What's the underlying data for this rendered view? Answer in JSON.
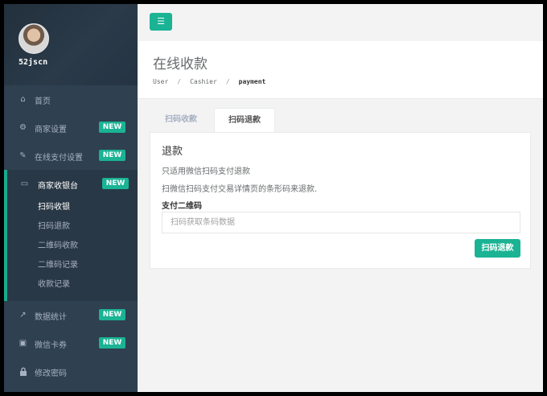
{
  "profile": {
    "username": "52jscn"
  },
  "topbar": {
    "menu_icon": "☰"
  },
  "sidebar": {
    "items": [
      {
        "label": "首页",
        "icon": "home-icon",
        "glyph": "⌂",
        "badge": ""
      },
      {
        "label": "商家设置",
        "icon": "cogs-icon",
        "glyph": "⚙",
        "badge": "NEW"
      },
      {
        "label": "在线支付设置",
        "icon": "wrench-icon",
        "glyph": "✎",
        "badge": "NEW"
      }
    ],
    "group": {
      "label": "商家收银台",
      "icon": "laptop-icon",
      "glyph": "▭",
      "badge": "NEW",
      "subitems": [
        "扫码收银",
        "扫码退款",
        "二维码收款",
        "二维码记录",
        "收款记录"
      ]
    },
    "bottom_items": [
      {
        "label": "数据统计",
        "icon": "line-chart-icon",
        "glyph": "↗",
        "badge": "NEW"
      },
      {
        "label": "微信卡券",
        "icon": "ticket-icon",
        "glyph": "▣",
        "badge": "NEW"
      },
      {
        "label": "修改密码",
        "icon": "lock-icon",
        "glyph": "🔒",
        "badge": ""
      }
    ]
  },
  "heading": {
    "title": "在线收款",
    "breadcrumb": [
      "User",
      "Cashier",
      "payment"
    ],
    "separator": "/"
  },
  "tabs": [
    "扫码收款",
    "扫码退款"
  ],
  "panel": {
    "title": "退款",
    "line1": "只适用微信扫码支付退款",
    "line2": "扫微信扫码支付交易详情页的条形码来退款.",
    "field_label": "支付二维码",
    "input_placeholder": "扫码获取条码数据",
    "input_value": "",
    "button_label": "扫码退款"
  },
  "colors": {
    "sidebar": "#2f4050",
    "accent": "#1ab394",
    "background": "#f3f3f4"
  }
}
